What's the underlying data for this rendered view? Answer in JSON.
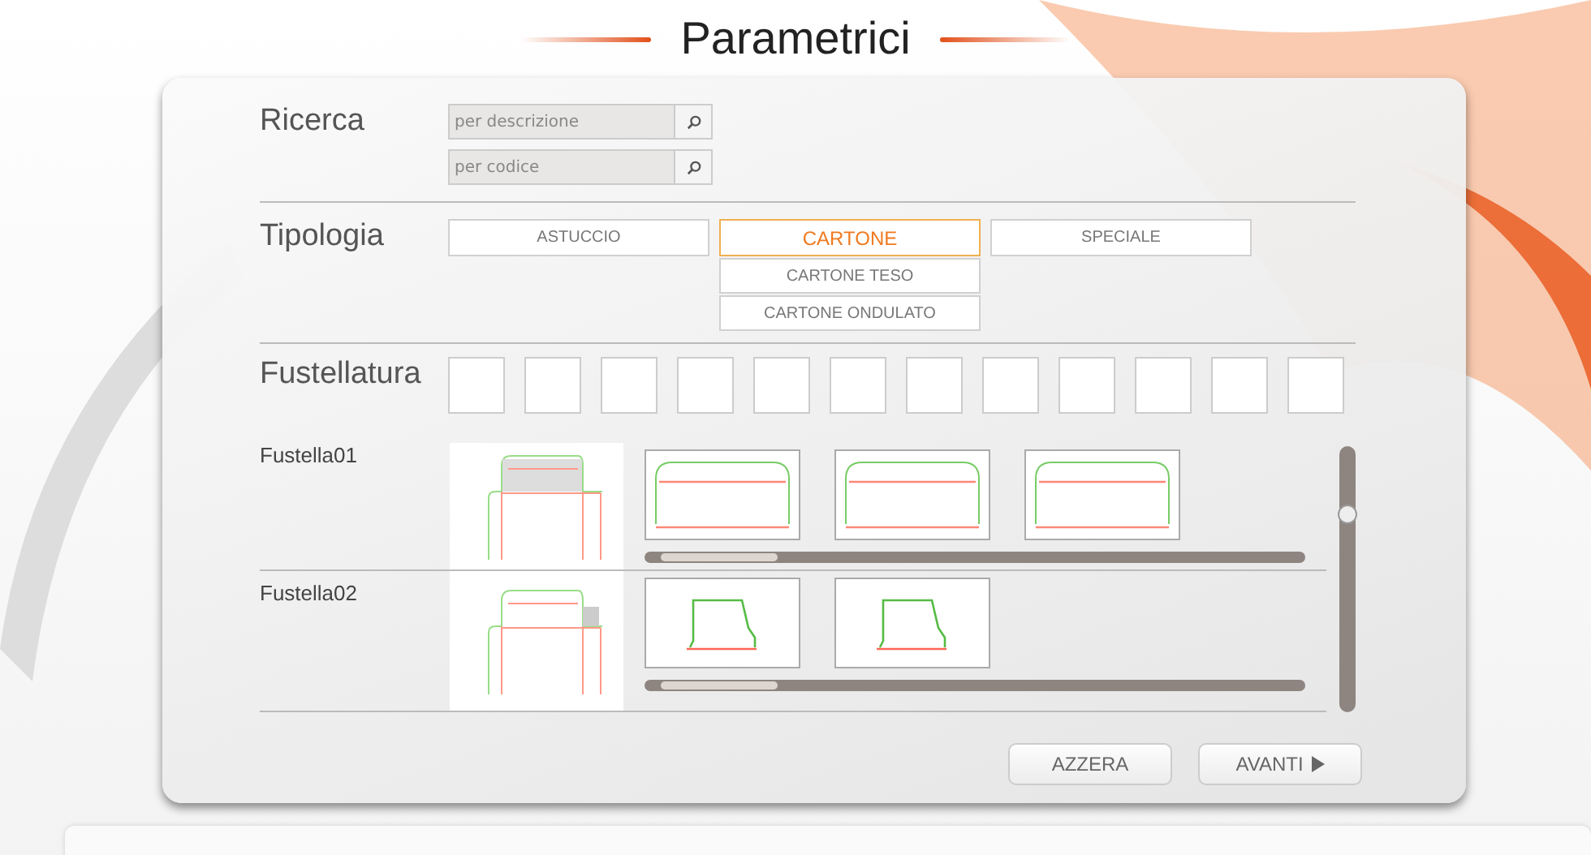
{
  "title": "Parametrici",
  "search": {
    "label": "Ricerca",
    "fields": [
      {
        "placeholder": "per descrizione"
      },
      {
        "placeholder": "per codice"
      }
    ]
  },
  "typology": {
    "label": "Tipologia",
    "types": [
      {
        "label": "ASTUCCIO",
        "selected": false
      },
      {
        "label": "CARTONE",
        "selected": true,
        "options": [
          "CARTONE TESO",
          "CARTONE ONDULATO"
        ]
      },
      {
        "label": "SPECIALE",
        "selected": false
      }
    ]
  },
  "die_cutting": {
    "label": "Fustellatura"
  },
  "dies": [
    {
      "label": "Fustella01",
      "preview": {
        "kind": "flap"
      },
      "thumbnails": [
        {
          "kind": "flap"
        },
        {
          "kind": "flap"
        },
        {
          "kind": "flap"
        }
      ]
    },
    {
      "label": "Fustella02",
      "preview": {
        "kind": "side"
      },
      "thumbnails": [
        {
          "kind": "trapezoid"
        },
        {
          "kind": "trapezoid"
        }
      ]
    }
  ],
  "buttons": [
    {
      "label": "AZZERA",
      "kind": "plain"
    },
    {
      "label": "AVANTI",
      "kind": "next"
    }
  ]
}
